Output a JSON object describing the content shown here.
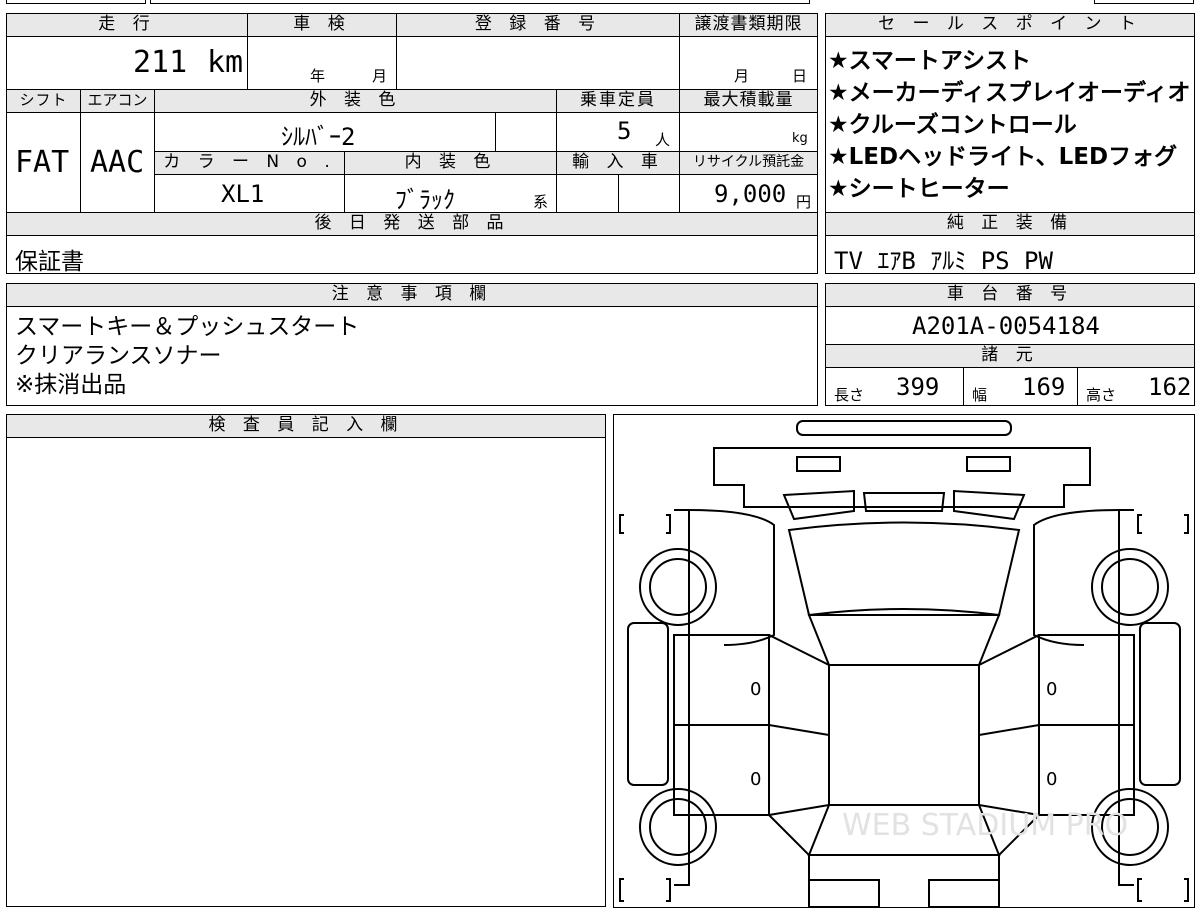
{
  "headers": {
    "mileage": "走 行",
    "inspection": "車 検",
    "registration": "登 録 番 号",
    "transfer_deadline": "譲渡書類期限",
    "sales_points": "セ ー ル ス ポ イ ン ト",
    "shift": "シフト",
    "aircon": "エアコン",
    "exterior_color": "外 装 色",
    "capacity": "乗車定員",
    "max_load": "最大積載量",
    "color_no": "カ ラ ー N o .",
    "interior_color": "内 装 色",
    "import": "輸 入 車",
    "recycle": "リサイクル預託金",
    "later_parts": "後 日 発 送 部 品",
    "genuine_equipment": "純 正 装 備",
    "notes": "注 意 事 項 欄",
    "chassis_number": "車 台 番 号",
    "specs": "諸 元",
    "inspector": "検 査 員 記 入 欄"
  },
  "vehicle": {
    "mileage_value": "211",
    "mileage_unit": "km",
    "inspection_year": "年",
    "inspection_month": "月",
    "transfer_month": "月",
    "transfer_day": "日",
    "shift": "FAT",
    "aircon": "AAC",
    "exterior_color": "ｼﾙﾊﾞｰ2",
    "capacity_value": "5",
    "capacity_unit": "人",
    "max_load_unit": "kg",
    "color_no": "XL1",
    "interior_color": "ﾌﾞﾗｯｸ",
    "interior_suffix": "系",
    "recycle_value": "9,000",
    "recycle_unit": "円",
    "later_parts": "保証書",
    "genuine_equipment": "TV ｴｱB ｱﾙﾐ PS PW",
    "chassis_number": "A201A-0054184"
  },
  "sales_points": [
    "★スマートアシスト",
    "★メーカーディスプレイオーディオ",
    "★クルーズコントロール",
    "★LEDヘッドライト、LEDフォグ",
    "★シートヒーター"
  ],
  "notes": [
    "スマートキー＆プッシュスタート",
    "クリアランスソナー",
    "※抹消出品"
  ],
  "specs": {
    "length_label": "長さ",
    "length_value": "399",
    "width_label": "幅",
    "width_value": "169",
    "height_label": "高さ",
    "height_value": "162"
  },
  "diagram": {
    "left_front_mark": "0",
    "left_rear_mark": "0",
    "right_front_mark": "0",
    "right_rear_mark": "0",
    "watermark": "WEB STADIUM PRO"
  }
}
